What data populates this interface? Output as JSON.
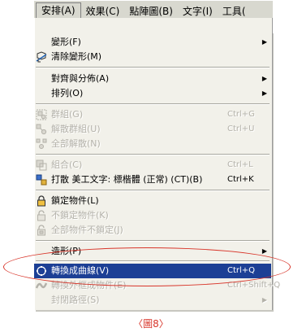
{
  "menubar": {
    "items": [
      "安排(A)",
      "效果(C)",
      "點陣圖(B)",
      "文字(I)",
      "工具("
    ]
  },
  "menu": {
    "items": [
      {
        "label": "變形(F)",
        "shortcut": "",
        "submenu": true,
        "disabled": false,
        "icon": "none"
      },
      {
        "label": "清除變形(M)",
        "shortcut": "",
        "submenu": false,
        "disabled": false,
        "icon": "clear-transform-icon"
      },
      {
        "label": "對齊與分佈(A)",
        "shortcut": "",
        "submenu": true,
        "disabled": false,
        "icon": "none"
      },
      {
        "label": "排列(O)",
        "shortcut": "",
        "submenu": true,
        "disabled": false,
        "icon": "none"
      },
      {
        "label": "群組(G)",
        "shortcut": "Ctrl+G",
        "submenu": false,
        "disabled": true,
        "icon": "group-icon"
      },
      {
        "label": "解散群組(U)",
        "shortcut": "Ctrl+U",
        "submenu": false,
        "disabled": true,
        "icon": "ungroup-icon"
      },
      {
        "label": "全部解散(N)",
        "shortcut": "",
        "submenu": false,
        "disabled": true,
        "icon": "ungroup-all-icon"
      },
      {
        "label": "組合(C)",
        "shortcut": "Ctrl+L",
        "submenu": false,
        "disabled": true,
        "icon": "combine-icon"
      },
      {
        "label": "打散 美工文字: 標楷體 (正常) (CT)(B)",
        "shortcut": "Ctrl+K",
        "submenu": false,
        "disabled": false,
        "icon": "break-apart-icon"
      },
      {
        "label": "鎖定物件(L)",
        "shortcut": "",
        "submenu": false,
        "disabled": false,
        "icon": "lock-icon"
      },
      {
        "label": "不鎖定物件(K)",
        "shortcut": "",
        "submenu": false,
        "disabled": true,
        "icon": "unlock-icon"
      },
      {
        "label": "全部物件不鎖定(J)",
        "shortcut": "",
        "submenu": false,
        "disabled": true,
        "icon": "unlock-all-icon"
      },
      {
        "label": "造形(P)",
        "shortcut": "",
        "submenu": true,
        "disabled": false,
        "icon": "none"
      },
      {
        "label": "轉換成曲線(V)",
        "shortcut": "Ctrl+Q",
        "submenu": false,
        "disabled": false,
        "selected": true,
        "icon": "convert-curves-icon"
      },
      {
        "label": "轉換外框成物件(E)",
        "shortcut": "Ctrl+Shift+Q",
        "submenu": false,
        "disabled": true,
        "icon": "outline-object-icon"
      },
      {
        "label": "封閉路徑(S)",
        "shortcut": "",
        "submenu": true,
        "disabled": true,
        "icon": "none"
      }
    ]
  },
  "caption": "〈圖8〉",
  "colors": {
    "menu_bg": "#f2f1ea",
    "selection": "#1c3f95",
    "annotation": "#d8352a",
    "disabled_text": "#b4b2aa"
  }
}
